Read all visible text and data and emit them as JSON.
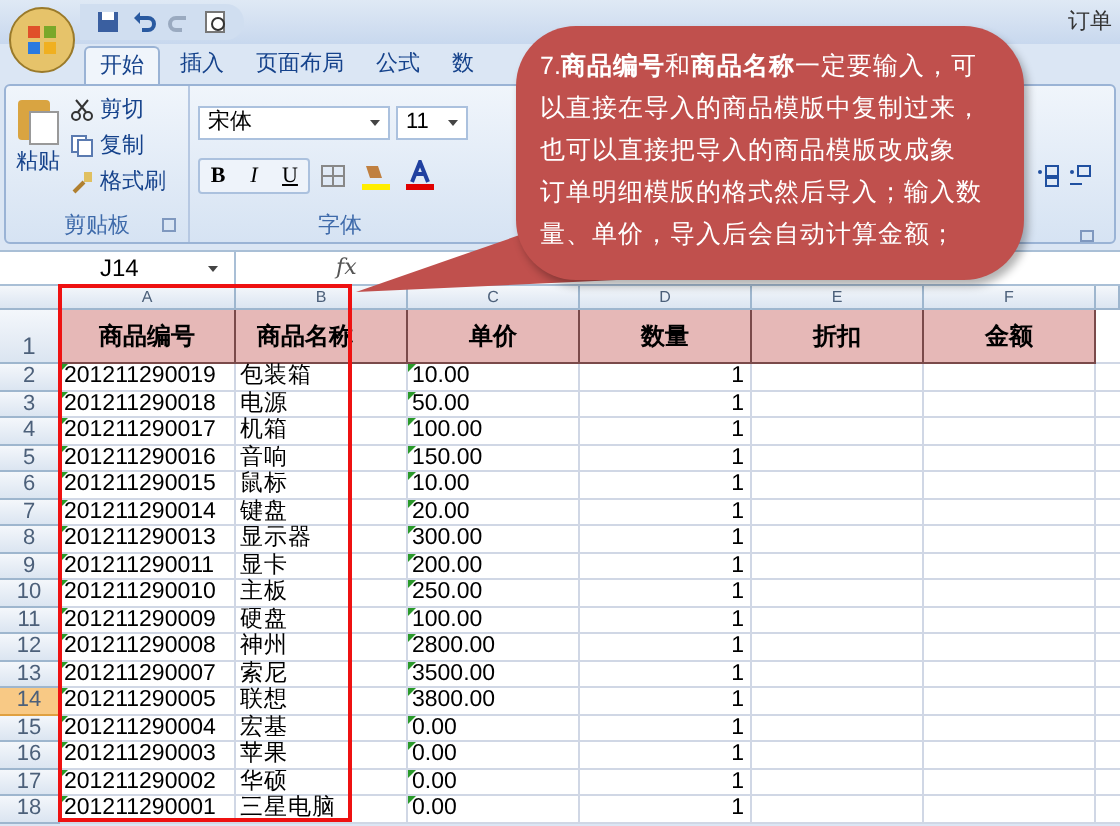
{
  "window": {
    "title": "订单"
  },
  "tabs": [
    {
      "label": "开始",
      "selected": true
    },
    {
      "label": "插入",
      "selected": false
    },
    {
      "label": "页面布局",
      "selected": false
    },
    {
      "label": "公式",
      "selected": false
    },
    {
      "label": "数",
      "selected": false
    }
  ],
  "ribbon": {
    "clipboard": {
      "label": "剪贴板",
      "paste": "粘贴",
      "commands": [
        "剪切",
        "复制",
        "格式刷"
      ]
    },
    "font": {
      "label": "字体",
      "font_name": "宋体",
      "font_size": "11",
      "styles": [
        "B",
        "I",
        "U"
      ]
    }
  },
  "formula_bar": {
    "name_box": "J14",
    "fx": "fx"
  },
  "sheet": {
    "columns": [
      {
        "letter": "A",
        "header": "商品编号",
        "flagged": true
      },
      {
        "letter": "B",
        "header": "商品名称",
        "flagged": false
      },
      {
        "letter": "C",
        "header": "单价",
        "flagged": true
      },
      {
        "letter": "D",
        "header": "数量",
        "flagged": false
      },
      {
        "letter": "E",
        "header": "折扣",
        "flagged": false
      },
      {
        "letter": "F",
        "header": "金额",
        "flagged": false
      }
    ],
    "header_row": "1",
    "rows": [
      {
        "row": "2",
        "cells": [
          "201211290019",
          "包装箱",
          "10.00",
          "1"
        ],
        "selected": false
      },
      {
        "row": "3",
        "cells": [
          "201211290018",
          "电源",
          "50.00",
          "1"
        ],
        "selected": false
      },
      {
        "row": "4",
        "cells": [
          "201211290017",
          "机箱",
          "100.00",
          "1"
        ],
        "selected": false
      },
      {
        "row": "5",
        "cells": [
          "201211290016",
          "音响",
          "150.00",
          "1"
        ],
        "selected": false
      },
      {
        "row": "6",
        "cells": [
          "201211290015",
          "鼠标",
          "10.00",
          "1"
        ],
        "selected": false
      },
      {
        "row": "7",
        "cells": [
          "201211290014",
          "键盘",
          "20.00",
          "1"
        ],
        "selected": false
      },
      {
        "row": "8",
        "cells": [
          "201211290013",
          "显示器",
          "300.00",
          "1"
        ],
        "selected": false
      },
      {
        "row": "9",
        "cells": [
          "201211290011",
          "显卡",
          "200.00",
          "1"
        ],
        "selected": false
      },
      {
        "row": "10",
        "cells": [
          "201211290010",
          "主板",
          "250.00",
          "1"
        ],
        "selected": false
      },
      {
        "row": "11",
        "cells": [
          "201211290009",
          "硬盘",
          "100.00",
          "1"
        ],
        "selected": false
      },
      {
        "row": "12",
        "cells": [
          "201211290008",
          "神州",
          "2800.00",
          "1"
        ],
        "selected": false
      },
      {
        "row": "13",
        "cells": [
          "201211290007",
          "索尼",
          "3500.00",
          "1"
        ],
        "selected": false
      },
      {
        "row": "14",
        "cells": [
          "201211290005",
          "联想",
          "3800.00",
          "1"
        ],
        "selected": true
      },
      {
        "row": "15",
        "cells": [
          "201211290004",
          "宏基",
          "0.00",
          "1"
        ],
        "selected": false
      },
      {
        "row": "16",
        "cells": [
          "201211290003",
          "苹果",
          "0.00",
          "1"
        ],
        "selected": false
      },
      {
        "row": "17",
        "cells": [
          "201211290002",
          "华硕",
          "0.00",
          "1"
        ],
        "selected": false
      },
      {
        "row": "18",
        "cells": [
          "201211290001",
          "三星电脑",
          "0.00",
          "1"
        ],
        "selected": false
      }
    ]
  },
  "callout": {
    "lines": [
      "7.**商品编号**和**商品名称**一定要输入，可",
      "以直接在导入的商品模版中复制过来，",
      "也可以直接把导入的商品模版改成象",
      "订单明细模版的格式然后导入；输入数",
      "量、单价，导入后会自动计算金额；"
    ]
  }
}
